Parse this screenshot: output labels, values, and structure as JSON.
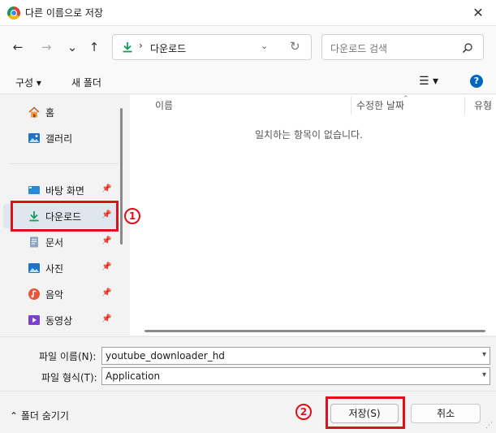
{
  "title": "다른 이름으로 저장",
  "close_glyph": "✕",
  "nav": {
    "back": "←",
    "forward": "→",
    "recent": "⌄",
    "up": "↑"
  },
  "address": {
    "separator": "›",
    "folder": "다운로드",
    "dropdown": "⌄",
    "refresh": "↻"
  },
  "search": {
    "placeholder": "다운로드 검색",
    "icon": "search-icon"
  },
  "toolbar": {
    "organize": "구성 ▾",
    "new_folder": "새 폴더",
    "view_glyph": "☰ ▾",
    "help": "?"
  },
  "sidebar": {
    "items": [
      {
        "label": "홈",
        "icon": "home-icon"
      },
      {
        "label": "갤러리",
        "icon": "gallery-icon"
      },
      {
        "label": "바탕 화면",
        "icon": "desktop-icon",
        "pinned": true
      },
      {
        "label": "다운로드",
        "icon": "download-icon",
        "pinned": true,
        "selected": true
      },
      {
        "label": "문서",
        "icon": "document-icon",
        "pinned": true
      },
      {
        "label": "사진",
        "icon": "pictures-icon",
        "pinned": true
      },
      {
        "label": "음악",
        "icon": "music-icon",
        "pinned": true
      },
      {
        "label": "동영상",
        "icon": "video-icon",
        "pinned": true
      }
    ],
    "pin_glyph": "📌"
  },
  "filelist": {
    "columns": [
      "이름",
      "수정한 날짜",
      "유형"
    ],
    "empty_message": "일치하는 항목이 없습니다."
  },
  "fields": {
    "filename_label": "파일 이름(N):",
    "filename_value": "youtube_downloader_hd",
    "filetype_label": "파일 형식(T):",
    "filetype_value": "Application"
  },
  "footer": {
    "hide_folders": "⌃ 폴더 숨기기",
    "save": "저장(S)",
    "cancel": "취소"
  },
  "annotations": {
    "marker1": "1",
    "marker2": "2"
  },
  "colors": {
    "highlight": "#e0101a",
    "accent": "#0067c0",
    "download_green": "#0f9d58"
  }
}
